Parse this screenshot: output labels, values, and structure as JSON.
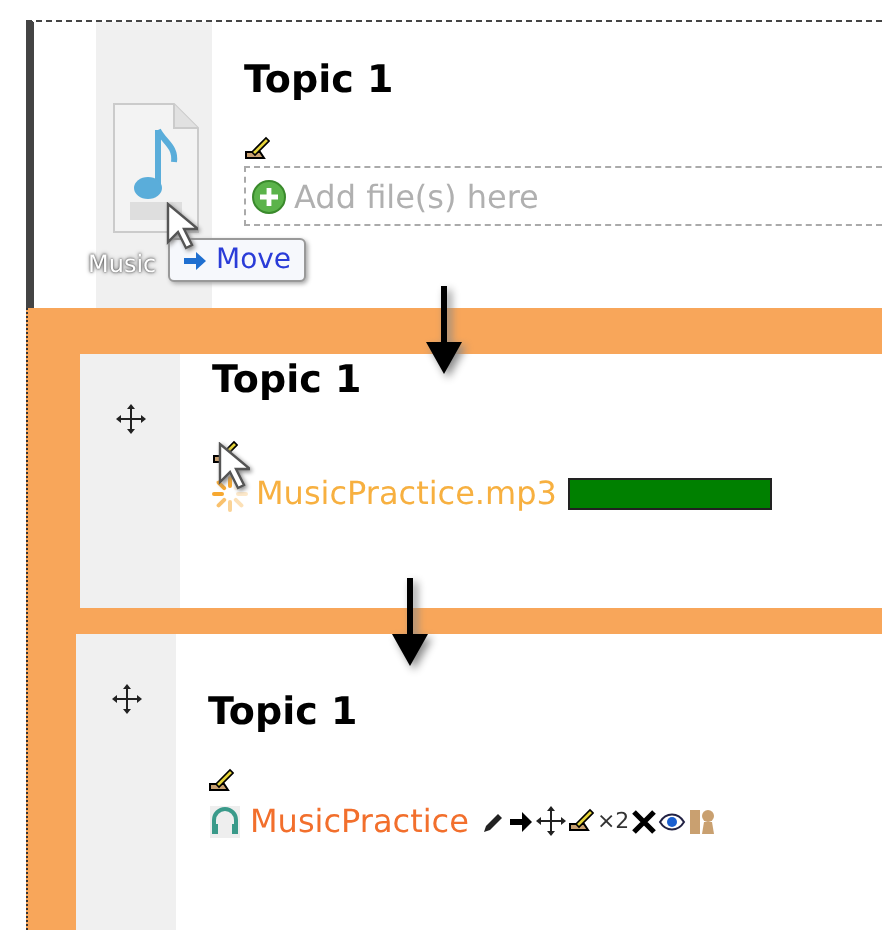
{
  "sections": [
    {
      "kind": "dragging",
      "title": "Topic 1",
      "dropzone_text": "Add file(s) here",
      "drag_label": "Music",
      "tooltip": "Move"
    },
    {
      "kind": "uploading",
      "title": "Topic 1",
      "file": {
        "name": "MusicPractice.mp3",
        "level": 1
      }
    },
    {
      "kind": "uploaded",
      "title": "Topic 1",
      "file": {
        "name": "MusicPractice",
        "indent_label": "×2"
      }
    }
  ]
}
